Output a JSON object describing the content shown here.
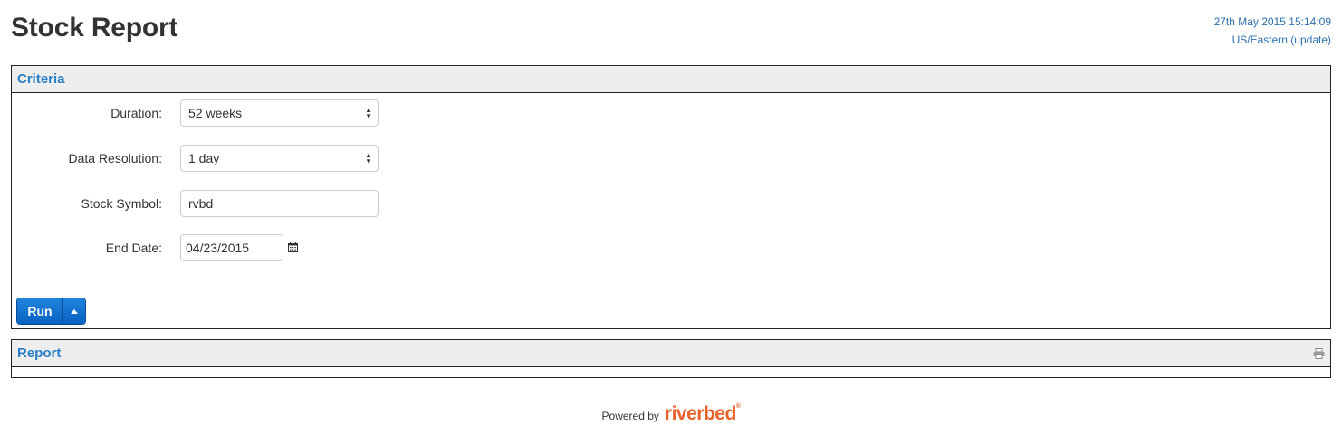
{
  "header": {
    "title": "Stock Report",
    "timestamp": "27th May 2015 15:14:09",
    "timezone": "US/Eastern (update)"
  },
  "criteria": {
    "title": "Criteria",
    "fields": [
      {
        "label": "Duration:",
        "type": "select",
        "value": "52 weeks"
      },
      {
        "label": "Data Resolution:",
        "type": "select",
        "value": "1 day"
      },
      {
        "label": "Stock Symbol:",
        "type": "text",
        "value": "rvbd"
      },
      {
        "label": "End Date:",
        "type": "date",
        "value": "04/23/2015"
      }
    ],
    "run_label": "Run"
  },
  "report": {
    "title": "Report"
  },
  "footer": {
    "powered_by": "Powered by",
    "brand": "riverbed",
    "brand_color": "#e8622c"
  },
  "icons": {
    "select_arrows": "select-arrows-icon",
    "calendar": "calendar-icon",
    "caret": "caret-up-icon",
    "print": "print-icon"
  },
  "colors": {
    "accent": "#2a7fc6",
    "button": "#0962c2",
    "panel_header_bg": "#eeeeee"
  }
}
